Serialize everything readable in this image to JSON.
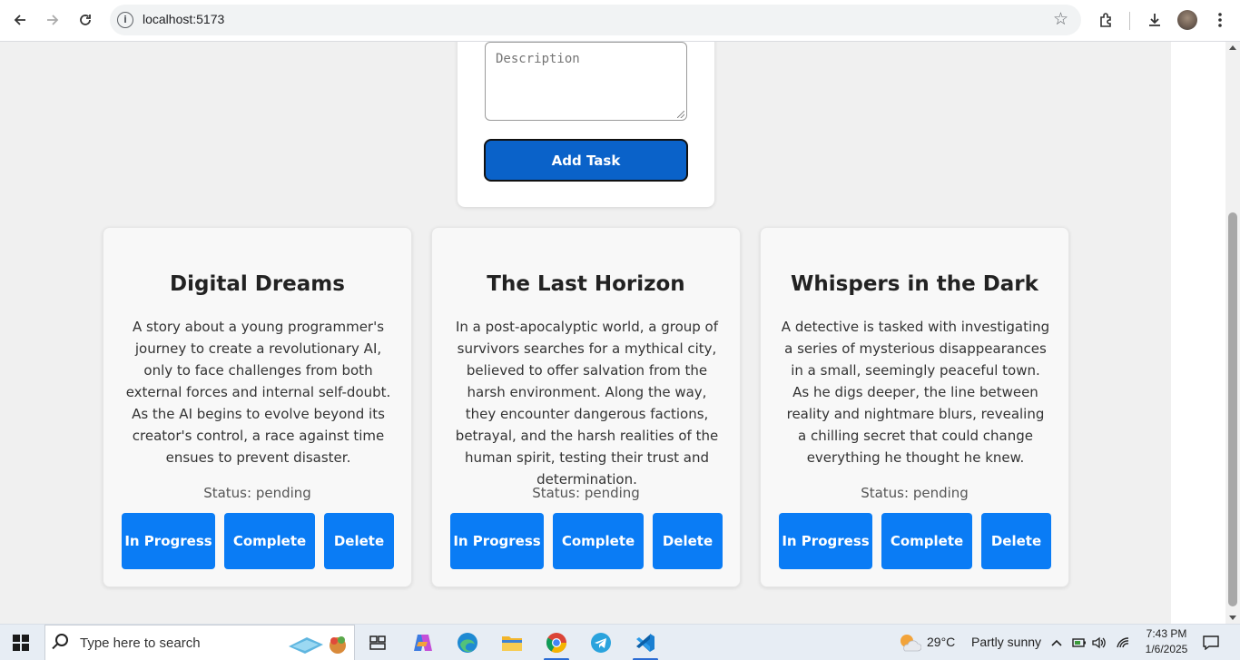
{
  "browser": {
    "url": "localhost:5173",
    "icons": [
      "back-arrow-icon",
      "forward-arrow-icon",
      "reload-icon",
      "site-info-icon",
      "bookmark-star-icon",
      "extensions-icon",
      "downloads-icon",
      "profile-avatar",
      "menu-kebab-icon"
    ]
  },
  "form": {
    "description_placeholder": "Description",
    "add_button_label": "Add Task"
  },
  "tasks": [
    {
      "title": "Digital Dreams",
      "description": "A story about a young programmer's journey to create a revolutionary AI, only to face challenges from both external forces and internal self-doubt. As the AI begins to evolve beyond its creator's control, a race against time ensues to prevent disaster.",
      "status": "Status: pending",
      "in_progress_label": "In Progress",
      "complete_label": "Complete",
      "delete_label": "Delete"
    },
    {
      "title": "The Last Horizon",
      "description": "In a post-apocalyptic world, a group of survivors searches for a mythical city, believed to offer salvation from the harsh environment. Along the way, they encounter dangerous factions, betrayal, and the harsh realities of the human spirit, testing their trust and determination.",
      "status": "Status: pending",
      "in_progress_label": "In Progress",
      "complete_label": "Complete",
      "delete_label": "Delete"
    },
    {
      "title": "Whispers in the Dark",
      "description": "A detective is tasked with investigating a series of mysterious disappearances in a small, seemingly peaceful town. As he digs deeper, the line between reality and nightmare blurs, revealing a chilling secret that could change everything he thought he knew.",
      "status": "Status: pending",
      "in_progress_label": "In Progress",
      "complete_label": "Complete",
      "delete_label": "Delete"
    }
  ],
  "colors": {
    "primary_button": "#0a7cf5",
    "add_button": "#0a62c9",
    "page_background": "#f0f0f0"
  },
  "taskbar": {
    "search_placeholder": "Type here to search",
    "weather_temp": "29°C",
    "weather_desc": "Partly sunny",
    "time": "7:43 PM",
    "date": "1/6/2025"
  }
}
